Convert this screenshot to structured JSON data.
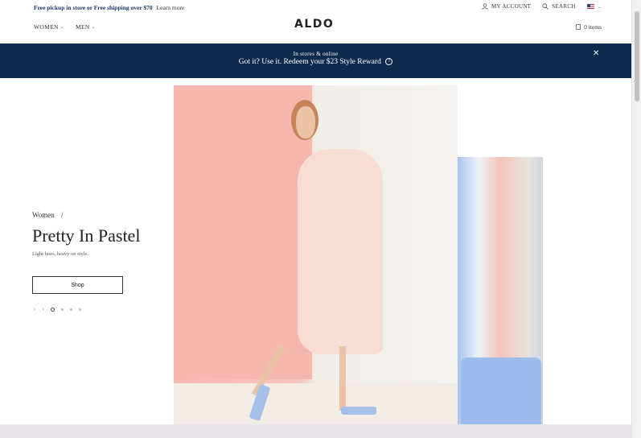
{
  "util_bar": {
    "promo_text": "Free pickup in store or Free shipping over $70",
    "learn_more": "Learn more",
    "my_account": "MY ACCOUNT",
    "search": "SEARCH",
    "country_chevron": "⌄"
  },
  "nav": {
    "women": "WOMEN",
    "men": "MEN",
    "logo": "ALDO",
    "cart": "0 items"
  },
  "banner": {
    "small_text": "In stores & online",
    "main_text": "Got it? Use it. Redeem your $23 Style Reward",
    "info": "?",
    "close": "✕"
  },
  "hero": {
    "breadcrumb": "Women",
    "breadcrumb_sep": "/",
    "title": "Pretty In Pastel",
    "subtitle": "Light hues, heavy on style.",
    "shop_label": "Shop",
    "prev": "‹",
    "next": "›"
  },
  "icons": {
    "account": "user-icon",
    "search": "search-icon",
    "flag": "us-flag-icon",
    "bag": "shopping-bag-icon",
    "close": "close-icon",
    "info": "question-circle-icon"
  },
  "colors": {
    "banner_bg": "#0d2a4f",
    "promo_text": "#1a3a6b"
  }
}
